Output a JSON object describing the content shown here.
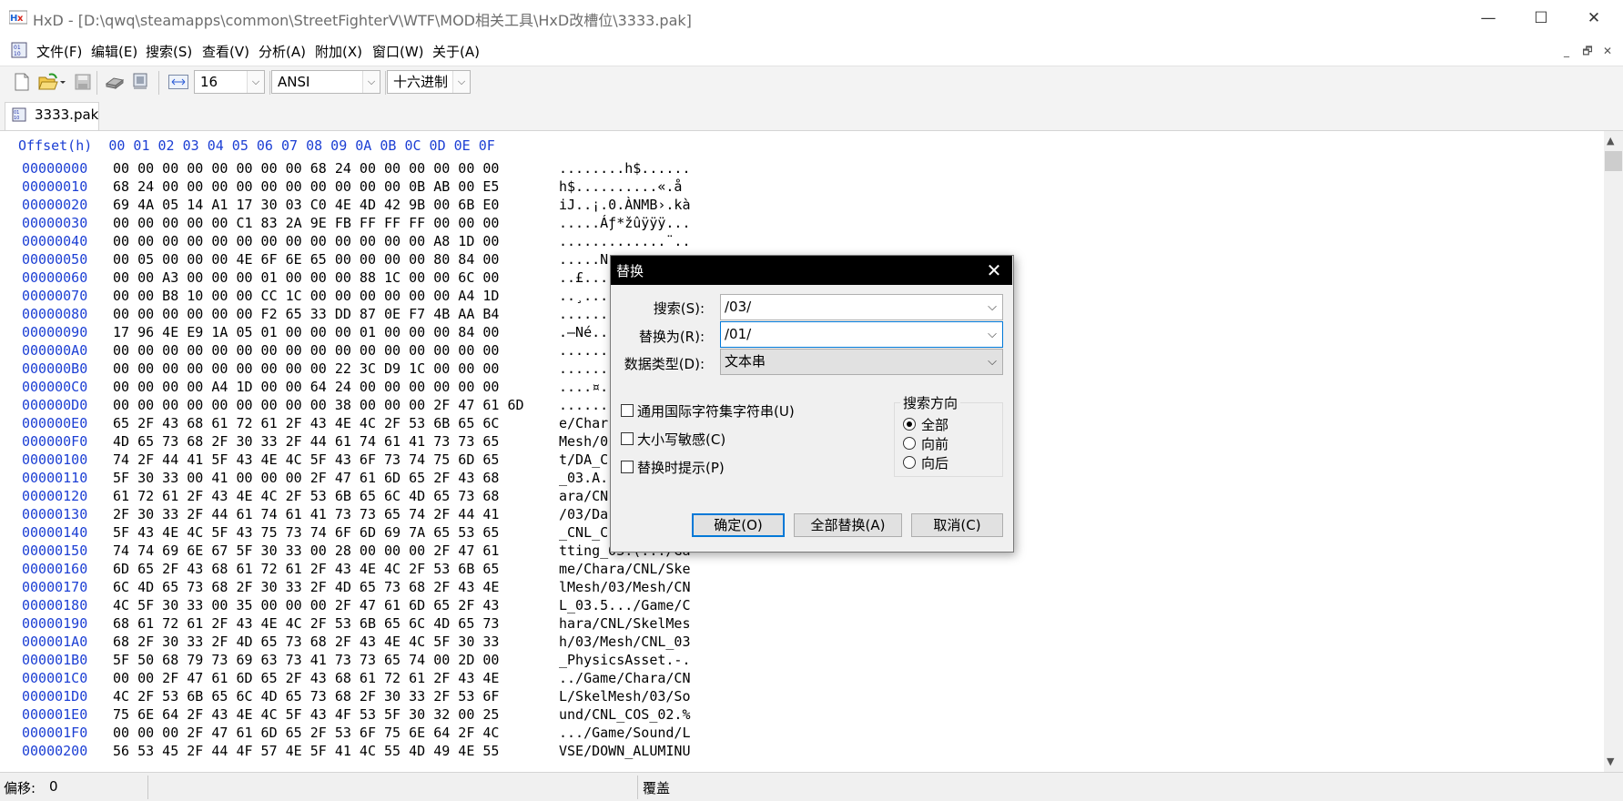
{
  "window": {
    "title": "HxD - [D:\\qwq\\steamapps\\common\\StreetFighterV\\WTF\\MOD相关工具\\HxD改槽位\\3333.pak]",
    "minimize_glyph": "—",
    "maximize_glyph": "☐",
    "close_glyph": "✕"
  },
  "menu": {
    "items": [
      "文件(F)",
      "编辑(E)",
      "搜索(S)",
      "查看(V)",
      "分析(A)",
      "附加(X)",
      "窗口(W)",
      "关于(A)"
    ],
    "mdi": [
      "_",
      "🗗",
      "✕"
    ]
  },
  "toolbar": {
    "bytes_per_row": "16",
    "charset": "ANSI",
    "offset_base": "十六进制",
    "icons": [
      "new-file-icon",
      "open-file-icon",
      "save-icon",
      "open-disk-icon",
      "open-ram-icon",
      "bytes-per-row-icon"
    ]
  },
  "tab": {
    "label": "3333.pak"
  },
  "hex": {
    "header": "Offset(h)  00 01 02 03 04 05 06 07 08 09 0A 0B 0C 0D 0E 0F",
    "rows": [
      {
        "off": "00000000",
        "hex": "00 00 00 00 00 00 00 00 68 24 00 00 00 00 00 00",
        "asc": "........h$......"
      },
      {
        "off": "00000010",
        "hex": "68 24 00 00 00 00 00 00 00 00 00 00 0B AB 00 E5",
        "asc": "h$..........«.å"
      },
      {
        "off": "00000020",
        "hex": "69 4A 05 14 A1 17 30 03 C0 4E 4D 42 9B 00 6B E0",
        "asc": "iJ..¡.0.ÀNMB›.kà"
      },
      {
        "off": "00000030",
        "hex": "00 00 00 00 00 C1 83 2A 9E FB FF FF FF 00 00 00",
        "asc": ".....Áƒ*žûÿÿÿ..."
      },
      {
        "off": "00000040",
        "hex": "00 00 00 00 00 00 00 00 00 00 00 00 00 A8 1D 00",
        "asc": ".............¨.."
      },
      {
        "off": "00000050",
        "hex": "00 05 00 00 00 4E 6F 6E 65 00 00 00 00 80 84 00",
        "asc": ".....N"
      },
      {
        "off": "00000060",
        "hex": "00 00 A3 00 00 00 01 00 00 00 88 1C 00 00 6C 00",
        "asc": "..£..."
      },
      {
        "off": "00000070",
        "hex": "00 00 B8 10 00 00 CC 1C 00 00 00 00 00 00 A4 1D",
        "asc": "..¸..."
      },
      {
        "off": "00000080",
        "hex": "00 00 00 00 00 00 F2 65 33 DD 87 0E F7 4B AA B4",
        "asc": "......"
      },
      {
        "off": "00000090",
        "hex": "17 96 4E E9 1A 05 01 00 00 00 01 00 00 00 84 00",
        "asc": ".–Né.."
      },
      {
        "off": "000000A0",
        "hex": "00 00 00 00 00 00 00 00 00 00 00 00 00 00 00 00",
        "asc": "......"
      },
      {
        "off": "000000B0",
        "hex": "00 00 00 00 00 00 00 00 00 22 3C D9 1C 00 00 00",
        "asc": "......"
      },
      {
        "off": "000000C0",
        "hex": "00 00 00 00 A4 1D 00 00 64 24 00 00 00 00 00 00",
        "asc": "....¤."
      },
      {
        "off": "000000D0",
        "hex": "00 00 00 00 00 00 00 00 00 38 00 00 00 2F 47 61 6D",
        "asc": "......"
      },
      {
        "off": "000000E0",
        "hex": "65 2F 43 68 61 72 61 2F 43 4E 4C 2F 53 6B 65 6C",
        "asc": "e/Char"
      },
      {
        "off": "000000F0",
        "hex": "4D 65 73 68 2F 30 33 2F 44 61 74 61 41 73 73 65",
        "asc": "Mesh/0"
      },
      {
        "off": "00000100",
        "hex": "74 2F 44 41 5F 43 4E 4C 5F 43 6F 73 74 75 6D 65",
        "asc": "t/DA_C"
      },
      {
        "off": "00000110",
        "hex": "5F 30 33 00 41 00 00 00 2F 47 61 6D 65 2F 43 68",
        "asc": "_03.A."
      },
      {
        "off": "00000120",
        "hex": "61 72 61 2F 43 4E 4C 2F 53 6B 65 6C 4D 65 73 68",
        "asc": "ara/CN"
      },
      {
        "off": "00000130",
        "hex": "2F 30 33 2F 44 61 74 61 41 73 73 65 74 2F 44 41",
        "asc": "/03/Da"
      },
      {
        "off": "00000140",
        "hex": "5F 43 4E 4C 5F 43 75 73 74 6F 6D 69 7A 65 53 65",
        "asc": "_CNL_C"
      },
      {
        "off": "00000150",
        "hex": "74 74 69 6E 67 5F 30 33 00 28 00 00 00 2F 47 61",
        "asc": "tting_03.(.../Ga"
      },
      {
        "off": "00000160",
        "hex": "6D 65 2F 43 68 61 72 61 2F 43 4E 4C 2F 53 6B 65",
        "asc": "me/Chara/CNL/Ske"
      },
      {
        "off": "00000170",
        "hex": "6C 4D 65 73 68 2F 30 33 2F 4D 65 73 68 2F 43 4E",
        "asc": "lMesh/03/Mesh/CN"
      },
      {
        "off": "00000180",
        "hex": "4C 5F 30 33 00 35 00 00 00 2F 47 61 6D 65 2F 43",
        "asc": "L_03.5.../Game/C"
      },
      {
        "off": "00000190",
        "hex": "68 61 72 61 2F 43 4E 4C 2F 53 6B 65 6C 4D 65 73",
        "asc": "hara/CNL/SkelMes"
      },
      {
        "off": "000001A0",
        "hex": "68 2F 30 33 2F 4D 65 73 68 2F 43 4E 4C 5F 30 33",
        "asc": "h/03/Mesh/CNL_03"
      },
      {
        "off": "000001B0",
        "hex": "5F 50 68 79 73 69 63 73 41 73 73 65 74 00 2D 00",
        "asc": "_PhysicsAsset.-."
      },
      {
        "off": "000001C0",
        "hex": "00 00 2F 47 61 6D 65 2F 43 68 61 72 61 2F 43 4E",
        "asc": "../Game/Chara/CN"
      },
      {
        "off": "000001D0",
        "hex": "4C 2F 53 6B 65 6C 4D 65 73 68 2F 30 33 2F 53 6F",
        "asc": "L/SkelMesh/03/So"
      },
      {
        "off": "000001E0",
        "hex": "75 6E 64 2F 43 4E 4C 5F 43 4F 53 5F 30 32 00 25",
        "asc": "und/CNL_COS_02.%"
      },
      {
        "off": "000001F0",
        "hex": "00 00 00 2F 47 61 6D 65 2F 53 6F 75 6E 64 2F 4C",
        "asc": ".../Game/Sound/L"
      },
      {
        "off": "00000200",
        "hex": "56 53 45 2F 44 4F 57 4E 5F 41 4C 55 4D 49 4E 55",
        "asc": "VSE/DOWN_ALUMINU"
      }
    ]
  },
  "status": {
    "offset_label": "偏移:",
    "offset_value": "0",
    "mode": "覆盖"
  },
  "dialog": {
    "title": "替换",
    "search_label": "搜索(S):",
    "search_value": "/03/",
    "replace_label": "替换为(R):",
    "replace_value": "/01/",
    "datatype_label": "数据类型(D):",
    "datatype_value": "文本串",
    "opt_unicode": "通用国际字符集字符串(U)",
    "opt_case": "大小写敏感(C)",
    "opt_prompt": "替换时提示(P)",
    "direction_title": "搜索方向",
    "dir_all": "全部",
    "dir_forward": "向前",
    "dir_backward": "向后",
    "ok": "确定(O)",
    "replace_all": "全部替换(A)",
    "cancel": "取消(C)",
    "selected_direction": "全部"
  },
  "colors": {
    "offset_blue": "#1c3fd4",
    "dialog_title_bg": "#000000",
    "focus_blue": "#0078d7"
  }
}
